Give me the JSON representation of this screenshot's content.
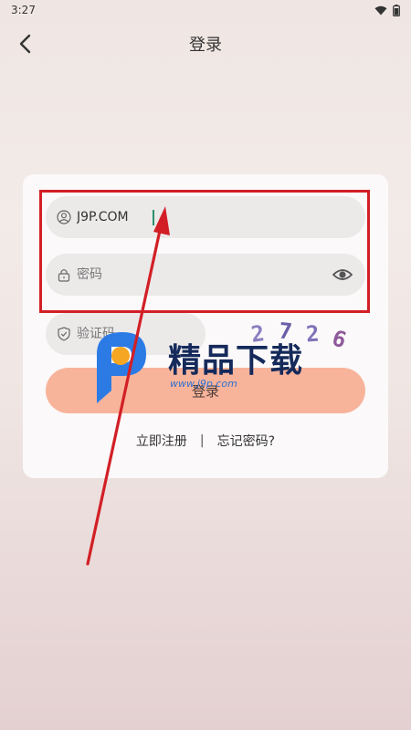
{
  "status_bar": {
    "time": "3:27"
  },
  "header": {
    "title": "登录",
    "back_icon": "chevron-left-icon"
  },
  "form": {
    "username": {
      "value": "J9P.COM",
      "icon": "user-circle-icon"
    },
    "password": {
      "placeholder": "密码",
      "icon": "lock-icon",
      "toggle_icon": "eye-icon"
    },
    "captcha": {
      "placeholder": "验证码",
      "icon": "shield-check-icon",
      "code_chars": [
        "2",
        "7",
        "2",
        "6"
      ]
    },
    "login_button_label": "登录"
  },
  "links": {
    "register": "立即注册",
    "separator": "|",
    "forgot": "忘记密码?"
  },
  "watermark": {
    "brand": "精品下载",
    "url": "www.j9p.com"
  },
  "colors": {
    "accent_button": "#f8b49b",
    "annotation_red": "#d21f26",
    "card_bg": "#fbf9f9",
    "field_bg": "#ece9e9"
  }
}
